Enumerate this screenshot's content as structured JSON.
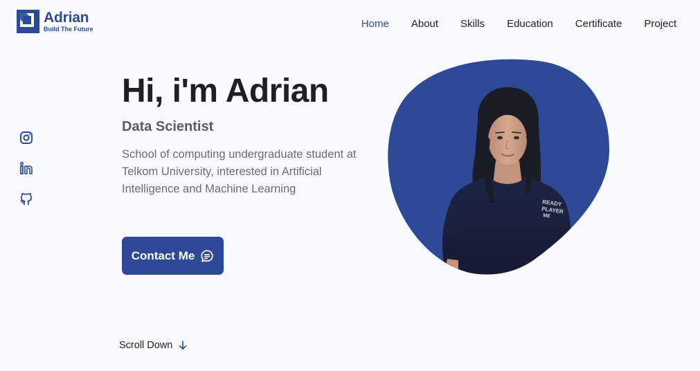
{
  "brand": {
    "name": "Adrian",
    "tagline": "Build The Future",
    "color": "#2e4a96"
  },
  "nav": {
    "items": [
      {
        "label": "Home",
        "active": true
      },
      {
        "label": "About",
        "active": false
      },
      {
        "label": "Skills",
        "active": false
      },
      {
        "label": "Education",
        "active": false
      },
      {
        "label": "Certificate",
        "active": false
      },
      {
        "label": "Project",
        "active": false
      }
    ]
  },
  "social": {
    "icons": [
      "instagram-icon",
      "linkedin-icon",
      "github-icon"
    ]
  },
  "hero": {
    "title": "Hi, i'm Adrian",
    "subtitle": "Data Scientist",
    "description": "School of computing undergraduate student at Telkom University, interested in Artificial Intelligence and Machine Learning",
    "contact_label": "Contact Me",
    "contact_icon": "chat-icon",
    "shirt_text": "READY PLAYER ME"
  },
  "scroll": {
    "label": "Scroll Down",
    "icon": "arrow-down-icon"
  },
  "colors": {
    "accent": "#2e4a96",
    "background": "#f9fafd",
    "text": "#1f1f24",
    "muted": "#6b6b75"
  }
}
